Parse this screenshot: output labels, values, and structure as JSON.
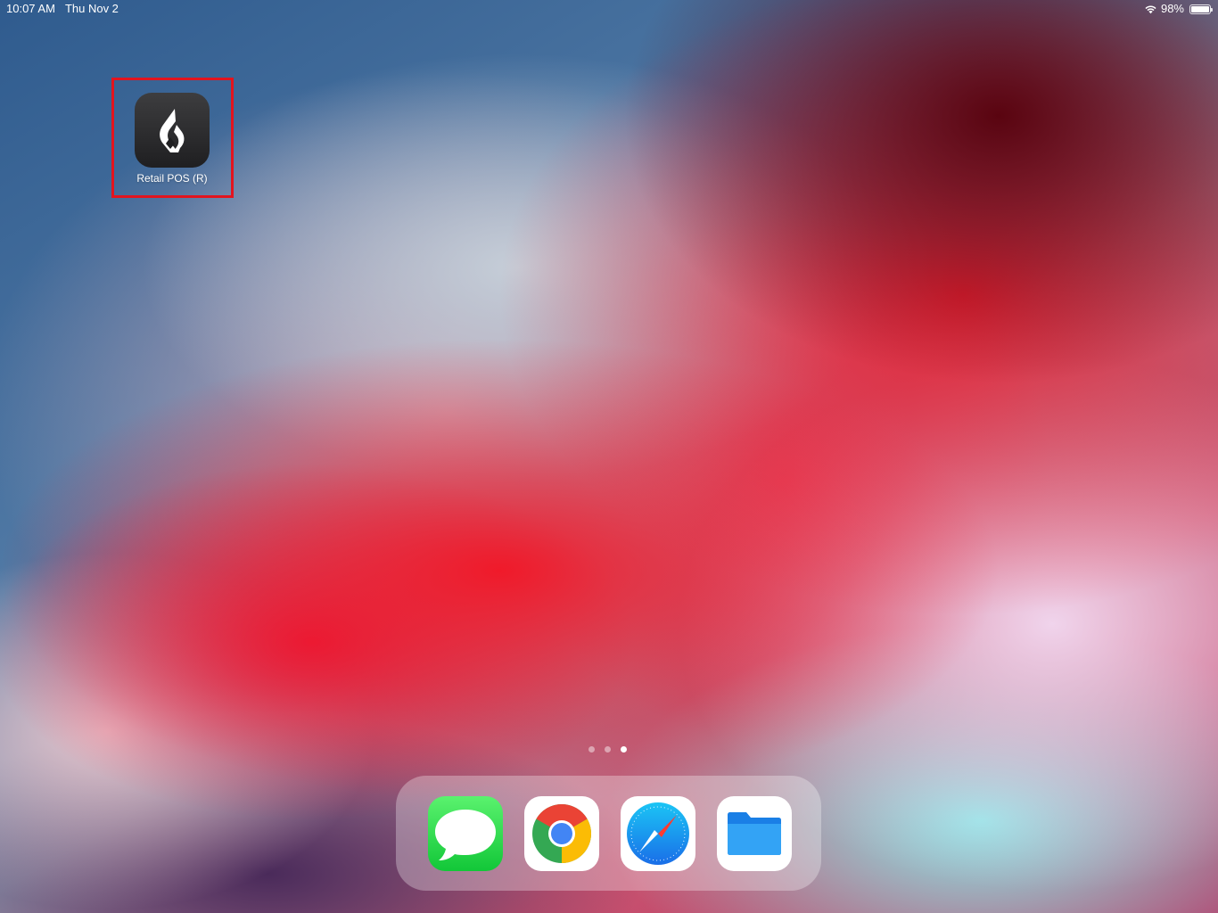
{
  "status_bar": {
    "time": "10:07 AM",
    "date": "Thu Nov 2",
    "battery_percent": "98%",
    "battery_level": 0.98,
    "wifi_icon": "wifi-icon",
    "battery_icon": "battery-icon"
  },
  "home_screen": {
    "apps": [
      {
        "label": "Retail POS (R)",
        "icon": "lightspeed-flame-icon",
        "highlighted": true
      }
    ],
    "highlight_color": "#e3141e",
    "page_count": 3,
    "active_page": 3
  },
  "dock": {
    "apps": [
      {
        "name": "Messages",
        "icon": "messages-icon",
        "color": "#1fd14a"
      },
      {
        "name": "Chrome",
        "icon": "chrome-icon",
        "color": "#4285f4"
      },
      {
        "name": "Safari",
        "icon": "safari-icon",
        "color": "#1a8cf0"
      },
      {
        "name": "Files",
        "icon": "files-icon",
        "color": "#1e8ff0"
      }
    ]
  }
}
